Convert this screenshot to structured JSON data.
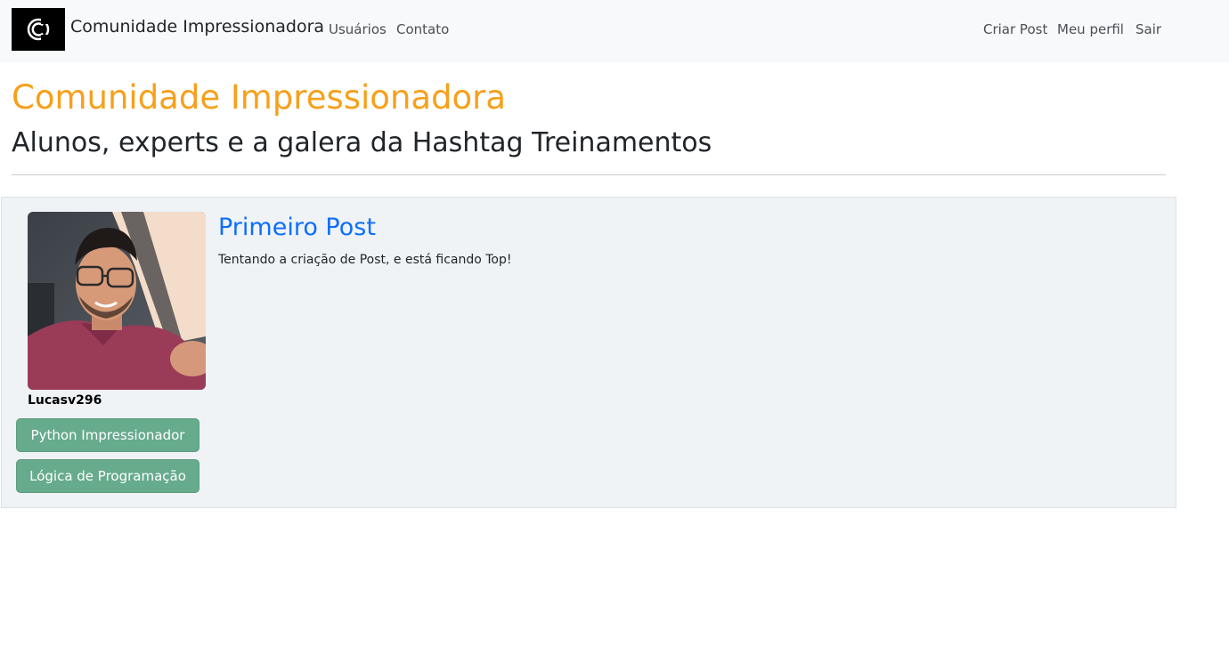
{
  "navbar": {
    "logo_icon": "community-c-logo",
    "brand": "Comunidade Impressionadora",
    "left_links": [
      "Usuários",
      "Contato"
    ],
    "right_links": [
      "Criar Post",
      "Meu perfil",
      "Sair"
    ]
  },
  "header": {
    "title": "Comunidade Impressionadora",
    "subtitle": "Alunos, experts e a galera da Hashtag Treinamentos"
  },
  "post": {
    "author": {
      "username": "Lucasv296",
      "courses": [
        "Python Impressionador",
        "Lógica de Programação"
      ]
    },
    "title": "Primeiro Post",
    "body": "Tentando a criação de Post, e está ficando Top!"
  },
  "colors": {
    "title_accent": "#f7a01a",
    "post_title": "#0d6efd",
    "tag_button": "#66ab8c",
    "card_bg": "#f0f3f6"
  }
}
